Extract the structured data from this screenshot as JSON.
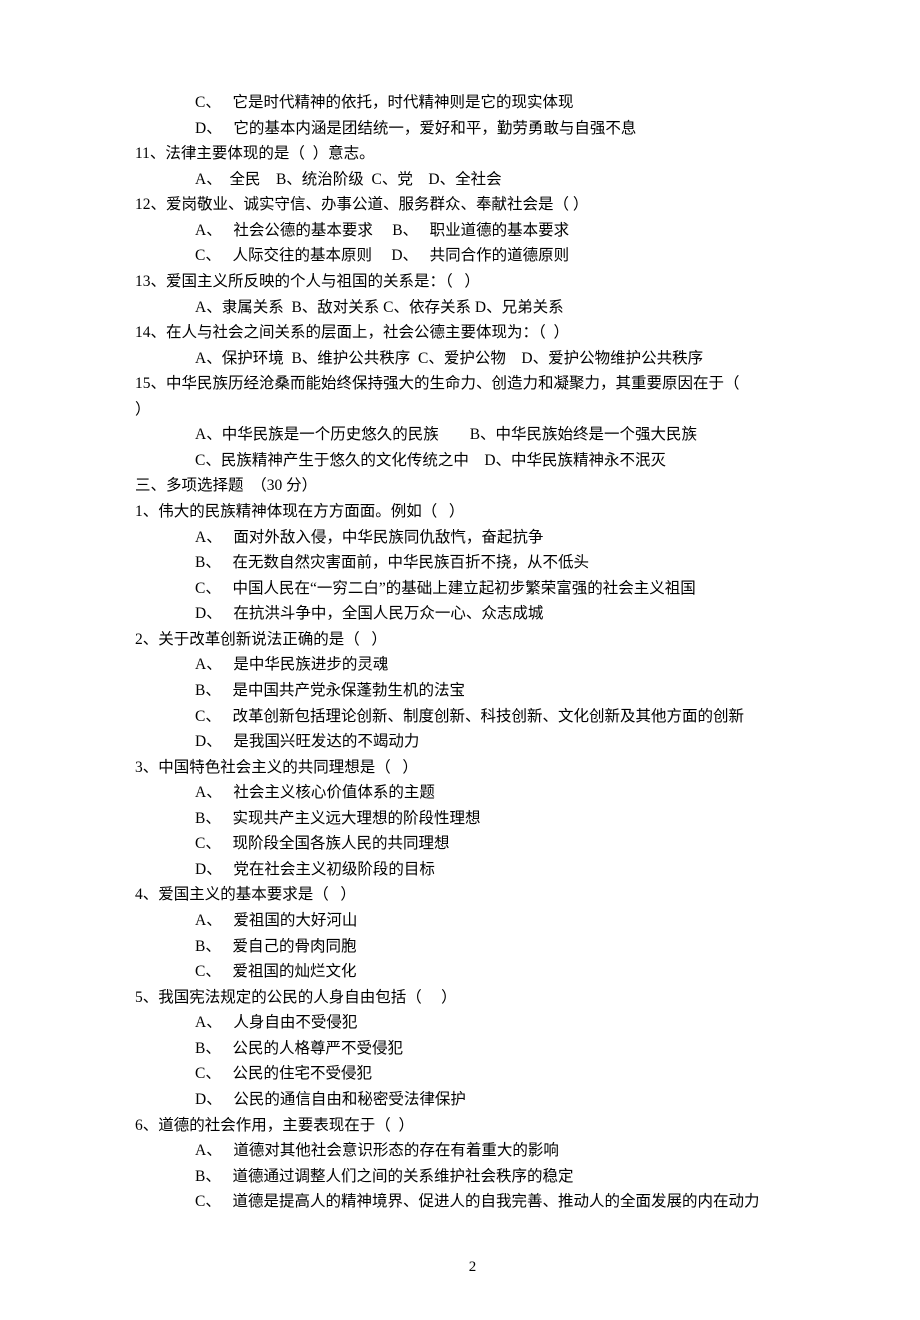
{
  "prelude": {
    "c": "C、   它是时代精神的依托，时代精神则是它的现实体现",
    "d": "D、   它的基本内涵是团结统一，爱好和平，勤劳勇敢与自强不息"
  },
  "sec2": {
    "q11": {
      "stem": "11、法律主要体现的是（  ）意志。",
      "opts": "A、  全民    B、统治阶级  C、党    D、全社会"
    },
    "q12": {
      "stem": "12、爱岗敬业、诚实守信、办事公道、服务群众、奉献社会是（ ）",
      "row1": "A、   社会公德的基本要求     B、   职业道德的基本要求",
      "row2": "C、   人际交往的基本原则     D、   共同合作的道德原则"
    },
    "q13": {
      "stem": "13、爱国主义所反映的个人与祖国的关系是：（   ）",
      "opts": "A、隶属关系  B、敌对关系 C、依存关系 D、兄弟关系"
    },
    "q14": {
      "stem": "14、在人与社会之间关系的层面上，社会公德主要体现为：（  ）",
      "opts": "A、保护环境  B、维护公共秩序  C、爱护公物    D、爱护公物维护公共秩序"
    },
    "q15": {
      "stem1": "15、中华民族历经沧桑而能始终保持强大的生命力、创造力和凝聚力，其重要原因在于（  ",
      "stem2": "）",
      "row1": "A、中华民族是一个历史悠久的民族        B、中华民族始终是一个强大民族",
      "row2": "C、民族精神产生于悠久的文化传统之中    D、中华民族精神永不泯灭"
    }
  },
  "sec3": {
    "header": "三、多项选择题  （30 分）",
    "q1": {
      "stem": "1、伟大的民族精神体现在方方面面。例如（   ）",
      "a": "A、   面对外敌入侵，中华民族同仇敌忾，奋起抗争",
      "b": "B、   在无数自然灾害面前，中华民族百折不挠，从不低头",
      "c": "C、   中国人民在“一穷二白”的基础上建立起初步繁荣富强的社会主义祖国",
      "d": "D、   在抗洪斗争中，全国人民万众一心、众志成城"
    },
    "q2": {
      "stem": "2、关于改革创新说法正确的是（   ）",
      "a": "A、   是中华民族进步的灵魂",
      "b": "B、   是中国共产党永保蓬勃生机的法宝",
      "c": "C、   改革创新包括理论创新、制度创新、科技创新、文化创新及其他方面的创新",
      "d": "D、   是我国兴旺发达的不竭动力"
    },
    "q3": {
      "stem": "3、中国特色社会主义的共同理想是（   ）",
      "a": "A、   社会主义核心价值体系的主题",
      "b": "B、   实现共产主义远大理想的阶段性理想",
      "c": "C、   现阶段全国各族人民的共同理想",
      "d": "D、   党在社会主义初级阶段的目标"
    },
    "q4": {
      "stem": "4、爱国主义的基本要求是（   ）",
      "a": "A、   爱祖国的大好河山",
      "b": "B、   爱自己的骨肉同胞",
      "c": "C、   爱祖国的灿烂文化"
    },
    "q5": {
      "stem": "5、我国宪法规定的公民的人身自由包括（     ）",
      "a": "A、   人身自由不受侵犯",
      "b": "B、   公民的人格尊严不受侵犯",
      "c": "C、   公民的住宅不受侵犯",
      "d": "D、   公民的通信自由和秘密受法律保护"
    },
    "q6": {
      "stem": "6、道德的社会作用，主要表现在于（  ）",
      "a": "A、   道德对其他社会意识形态的存在有着重大的影响",
      "b": "B、   道德通过调整人们之间的关系维护社会秩序的稳定",
      "c": "C、   道德是提高人的精神境界、促进人的自我完善、推动人的全面发展的内在动力"
    }
  },
  "page_number": "2"
}
